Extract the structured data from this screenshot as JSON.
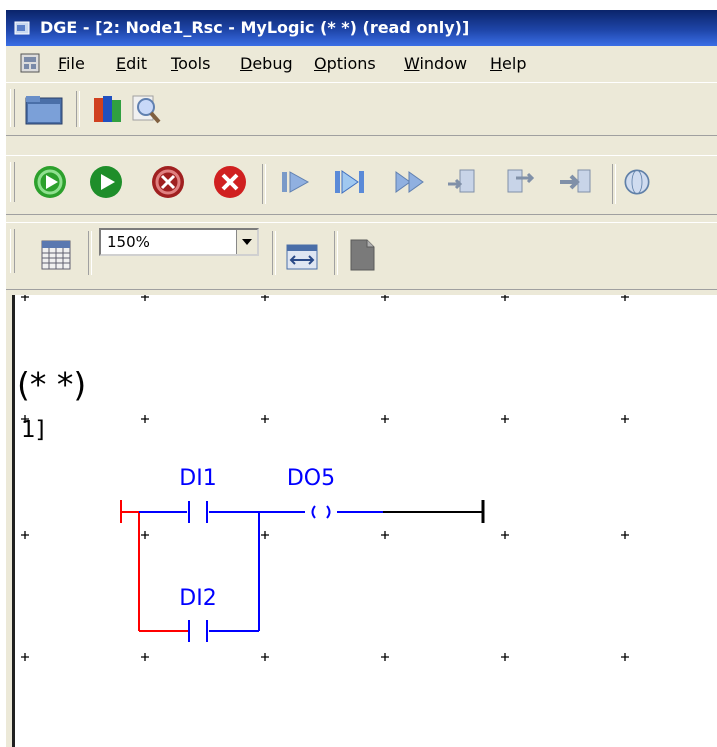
{
  "window": {
    "title": "DGE - [2: Node1_Rsc - MyLogic (*  *) (read only)]"
  },
  "menu": {
    "items": [
      "File",
      "Edit",
      "Tools",
      "Debug",
      "Options",
      "Window",
      "Help"
    ]
  },
  "toolbar_zoom": {
    "value": "150%"
  },
  "diagram": {
    "comment": "(*  *)",
    "rung_number": "1]",
    "contacts": [
      "DI1",
      "DI2"
    ],
    "coil": "DO5"
  },
  "colors": {
    "wire_active": "#0000ff",
    "wire_inactive": "#000000",
    "power_rail": "#ff0000",
    "label": "#0000ff"
  }
}
